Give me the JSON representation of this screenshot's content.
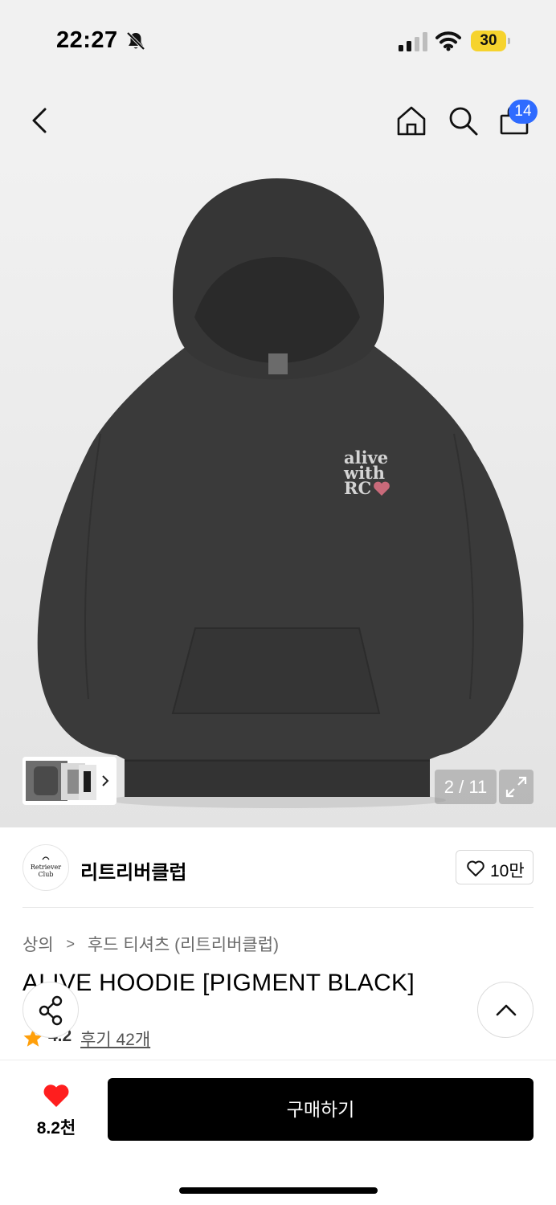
{
  "status_bar": {
    "time": "22:27",
    "battery": "30"
  },
  "nav": {
    "cart_count": "14"
  },
  "gallery": {
    "counter": "2 / 11",
    "print_text": [
      "alive",
      "with",
      "RC"
    ]
  },
  "brand": {
    "name": "리트리버클럽",
    "logo_text": [
      "Retriever",
      "Club"
    ],
    "likes": "10만"
  },
  "breadcrumb": {
    "level1": "상의",
    "separator": ">",
    "level2": "후드 티셔츠 (리트리버클럽)"
  },
  "product": {
    "title": "ALIVE HOODIE [PIGMENT BLACK]",
    "rating": "4.2",
    "reviews": "후기 42개"
  },
  "purchase": {
    "wish_count": "8.2천",
    "buy_label": "구매하기"
  },
  "colors": {
    "accent_blue": "#2f6bff",
    "heart_red": "#ff1e1e",
    "star_orange": "#ff9f0a",
    "battery_yellow": "#f6d32d"
  }
}
